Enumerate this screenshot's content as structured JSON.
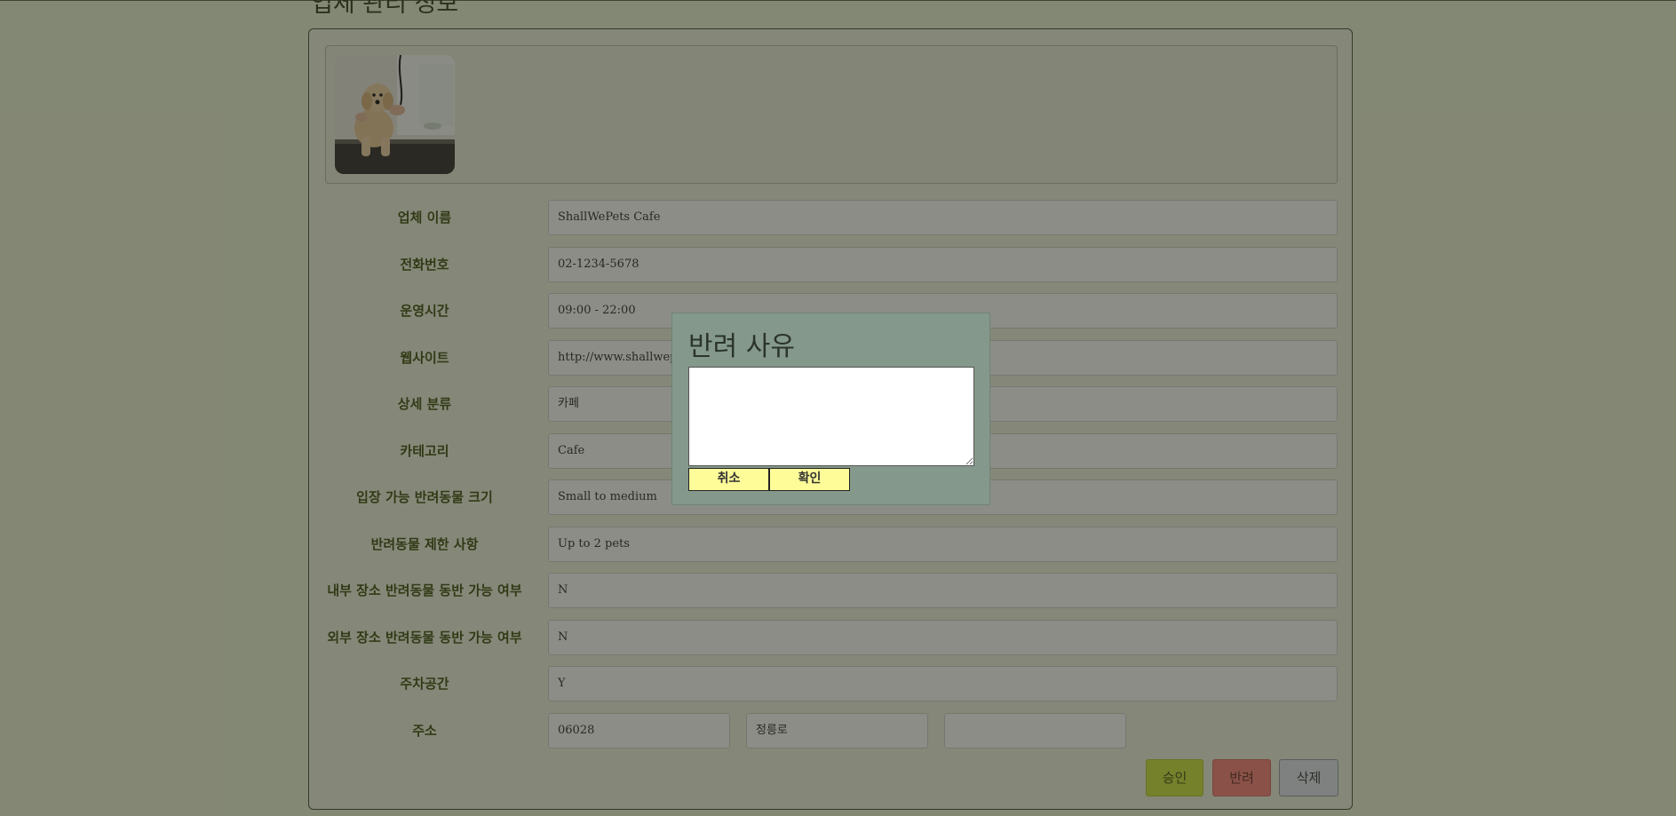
{
  "page": {
    "title": "업체 관리 정보"
  },
  "fields": [
    {
      "label": "업체 이름",
      "value": "ShallWePets Cafe"
    },
    {
      "label": "전화번호",
      "value": "02-1234-5678"
    },
    {
      "label": "운영시간",
      "value": "09:00 - 22:00"
    },
    {
      "label": "웹사이트",
      "value": "http://www.shallwepets.com"
    },
    {
      "label": "상세 분류",
      "value": "카페"
    },
    {
      "label": "카테고리",
      "value": "Cafe"
    },
    {
      "label": "입장 가능 반려동물 크기",
      "value": "Small to medium"
    },
    {
      "label": "반려동물 제한 사항",
      "value": "Up to 2 pets"
    },
    {
      "label": "내부 장소 반려동물 동반 가능 여부",
      "value": "N"
    },
    {
      "label": "외부 장소 반려동물 동반 가능 여부",
      "value": "N"
    },
    {
      "label": "주차공간",
      "value": "Y"
    }
  ],
  "address": {
    "label": "주소",
    "zipcode": "06028",
    "road": "정릉로",
    "detail": ""
  },
  "actions": {
    "approve": "승인",
    "reject": "반려",
    "delete": "삭제"
  },
  "modal": {
    "title": "반려 사유",
    "reason": "",
    "cancel": "취소",
    "confirm": "확인"
  },
  "photo": {
    "icon": "dog-photo"
  },
  "colors": {
    "approve": "#cfe34a",
    "reject": "#f3867f",
    "delete": "#dfe3ec",
    "modal_bg": "#84998b",
    "modal_button": "#fefc98"
  }
}
